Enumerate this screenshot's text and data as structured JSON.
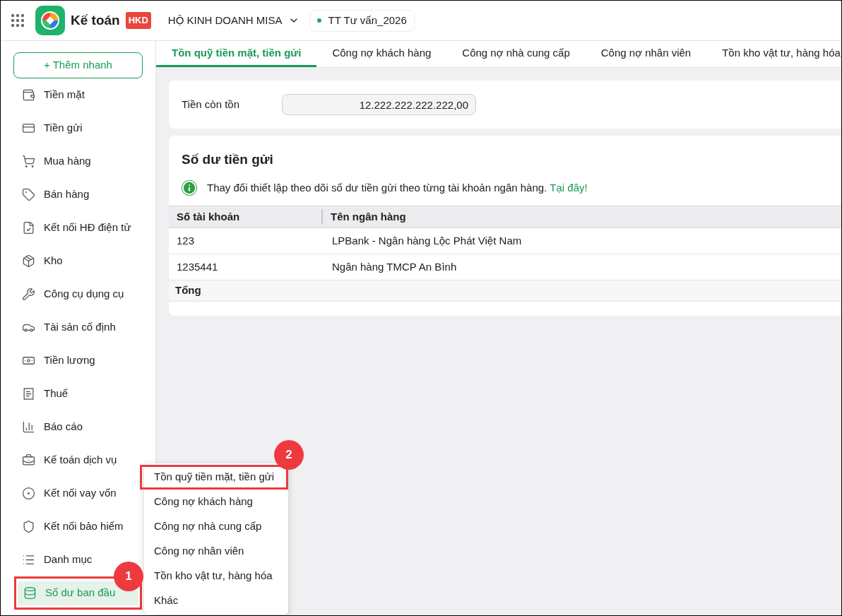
{
  "header": {
    "app_name": "Kế toán",
    "badge": "HKD",
    "company": "HỘ KINH DOANH MISA",
    "workspace": "TT Tư vấn_2026"
  },
  "sidebar": {
    "quick_add": "+ Thêm nhanh",
    "items": [
      {
        "label": "Tiền mặt",
        "selected": false,
        "highlighted": false
      },
      {
        "label": "Tiền gửi",
        "selected": false,
        "highlighted": false
      },
      {
        "label": "Mua hàng",
        "selected": false,
        "highlighted": false
      },
      {
        "label": "Bán hàng",
        "selected": false,
        "highlighted": false
      },
      {
        "label": "Kết nối HĐ điện tử",
        "selected": false,
        "highlighted": false
      },
      {
        "label": "Kho",
        "selected": false,
        "highlighted": false
      },
      {
        "label": "Công cụ dụng cụ",
        "selected": false,
        "highlighted": false
      },
      {
        "label": "Tài sản cố định",
        "selected": false,
        "highlighted": false
      },
      {
        "label": "Tiền lương",
        "selected": false,
        "highlighted": false
      },
      {
        "label": "Thuế",
        "selected": false,
        "highlighted": false
      },
      {
        "label": "Báo cáo",
        "selected": false,
        "highlighted": false
      },
      {
        "label": "Kế toán dịch vụ",
        "selected": false,
        "highlighted": false
      },
      {
        "label": "Kết nối vay vốn",
        "selected": false,
        "highlighted": false
      },
      {
        "label": "Kết nối bảo hiểm",
        "selected": false,
        "highlighted": false
      },
      {
        "label": "Danh mục",
        "selected": false,
        "highlighted": false
      },
      {
        "label": "Số dư ban đầu",
        "selected": true,
        "highlighted": true
      }
    ]
  },
  "tabs": [
    {
      "label": "Tồn quỹ tiền mặt, tiền gửi",
      "selected": true
    },
    {
      "label": "Công nợ khách hàng",
      "selected": false
    },
    {
      "label": "Công nợ nhà cung cấp",
      "selected": false
    },
    {
      "label": "Công nợ nhân viên",
      "selected": false
    },
    {
      "label": "Tồn kho vật tư, hàng hóa",
      "selected": false
    }
  ],
  "cash": {
    "label": "Tiền còn tồn",
    "value": "12.222.222.222.222,00"
  },
  "deposits": {
    "title": "Số dư tiền gửi",
    "notice": "Thay đổi thiết lập theo dõi số dư tiền gửi theo từng tài khoản ngân hàng.",
    "notice_link": "Tại đây!",
    "columns": [
      "Số tài khoản",
      "Tên ngân hàng"
    ],
    "rows": [
      [
        "123",
        "LPBank - Ngân hàng Lộc Phát Việt Nam"
      ],
      [
        "1235441",
        "Ngân hàng TMCP An Bình"
      ]
    ],
    "total_label": "Tổng"
  },
  "submenu": {
    "items": [
      {
        "label": "Tồn quỹ tiền mặt, tiền gửi",
        "highlighted": true
      },
      {
        "label": "Công nợ khách hàng",
        "highlighted": false
      },
      {
        "label": "Công nợ nhà cung cấp",
        "highlighted": false
      },
      {
        "label": "Công nợ nhân viên",
        "highlighted": false
      },
      {
        "label": "Tồn kho vật tư, hàng hóa",
        "highlighted": false
      },
      {
        "label": "Khác",
        "highlighted": false
      }
    ]
  },
  "annotations": [
    {
      "label": "1"
    },
    {
      "label": "2"
    }
  ]
}
